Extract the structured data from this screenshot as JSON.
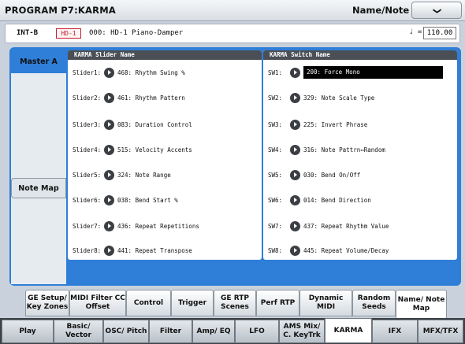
{
  "title": "PROGRAM P7:KARMA",
  "page_name": "Name/Note Map",
  "menu_glyph": "❯",
  "program": {
    "bank": "INT-B",
    "sub_bank": "HD-1",
    "name": "000: HD-1 Piano-Damper",
    "tempo_symbol": "♩ =",
    "tempo": "110.00"
  },
  "side_tabs": [
    "Master A",
    "Note Map"
  ],
  "slider_header": "KARMA Slider Name",
  "switch_header": "KARMA Switch Name",
  "sliders": [
    {
      "label": "Slider1:",
      "value": "468: Rhythm Swing %"
    },
    {
      "label": "Slider2:",
      "value": "461: Rhythm Pattern"
    },
    {
      "label": "Slider3:",
      "value": "083: Duration Control"
    },
    {
      "label": "Slider4:",
      "value": "515: Velocity Accents"
    },
    {
      "label": "Slider5:",
      "value": "324: Note Range"
    },
    {
      "label": "Slider6:",
      "value": "038: Bend Start %"
    },
    {
      "label": "Slider7:",
      "value": "436: Repeat Repetitions"
    },
    {
      "label": "Slider8:",
      "value": "441: Repeat Transpose"
    }
  ],
  "switches": [
    {
      "label": "SW1:",
      "value": "200: Force Mono",
      "selected": true
    },
    {
      "label": "SW2:",
      "value": "329: Note Scale Type"
    },
    {
      "label": "SW3:",
      "value": "225: Invert Phrase"
    },
    {
      "label": "SW4:",
      "value": "316: Note Pattrn⇔Random"
    },
    {
      "label": "SW5:",
      "value": "030: Bend On/Off"
    },
    {
      "label": "SW6:",
      "value": "014: Bend Direction"
    },
    {
      "label": "SW7:",
      "value": "437: Repeat Rhythm Value"
    },
    {
      "label": "SW8:",
      "value": "445: Repeat Volume/Decay"
    }
  ],
  "sub_tabs": [
    "GE Setup/ Key Zones",
    "MIDI Filter CC Offset",
    "Control",
    "Trigger",
    "GE RTP Scenes",
    "Perf RTP",
    "Dynamic MIDI",
    "Random Seeds",
    "Name/ Note Map"
  ],
  "main_tabs": [
    "Play",
    "Basic/ Vector",
    "OSC/ Pitch",
    "Filter",
    "Amp/ EQ",
    "LFO",
    "AMS Mix/ C. KeyTrk",
    "KARMA",
    "IFX",
    "MFX/TFX"
  ],
  "accent_color": "#2f7ed8"
}
